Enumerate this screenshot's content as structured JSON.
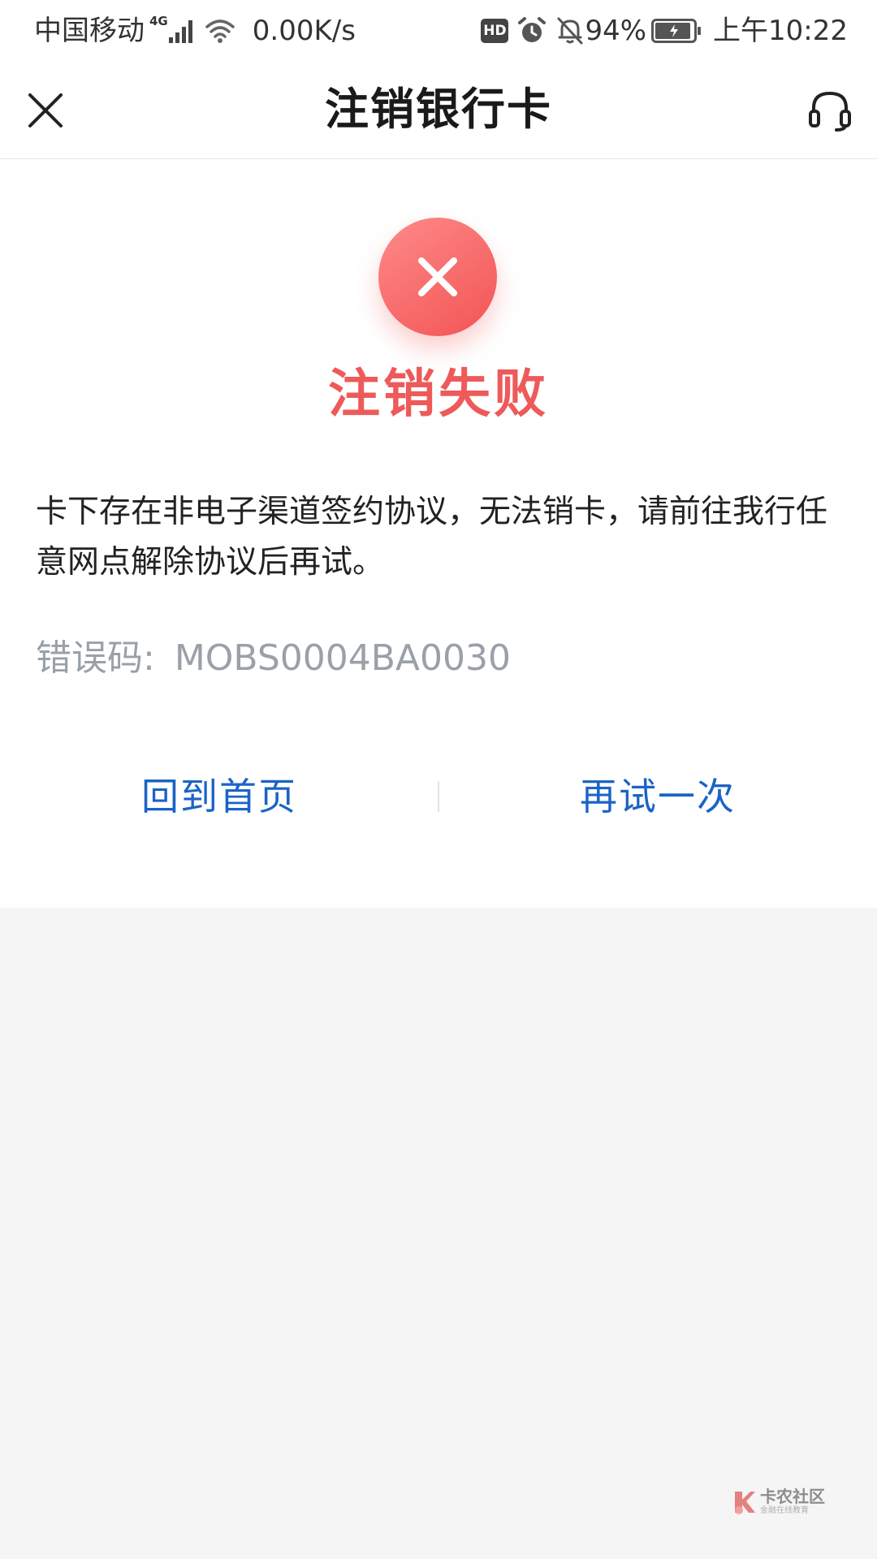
{
  "status_bar": {
    "carrier": "中国移动",
    "network_type": "4G",
    "net_speed": "0.00K/s",
    "hd_badge": "HD",
    "battery_level": "94%",
    "battery_fraction": 0.94,
    "time": "上午10:22",
    "icons": [
      "signal-icon",
      "wifi-icon",
      "alarm-icon",
      "bell-off-icon",
      "battery-charging-icon"
    ]
  },
  "nav": {
    "title": "注销银行卡",
    "close_icon": "close-icon",
    "service_icon": "headset-icon"
  },
  "result": {
    "status_icon": "close-circle-icon",
    "title": "注销失败",
    "message": "卡下存在非电子渠道签约协议，无法销卡，请前往我行任意网点解除协议后再试。",
    "error_label": "错误码:",
    "error_code": "MOBS0004BA0030"
  },
  "actions": {
    "home_label": "回到首页",
    "retry_label": "再试一次"
  },
  "watermark": {
    "name": "卡农社区",
    "tagline": "金融在线教育"
  },
  "colors": {
    "error_red": "#ee5a5a",
    "link_blue": "#1b63c6",
    "muted_gray": "#9aa0a8",
    "page_background": "#f5f5f6"
  }
}
